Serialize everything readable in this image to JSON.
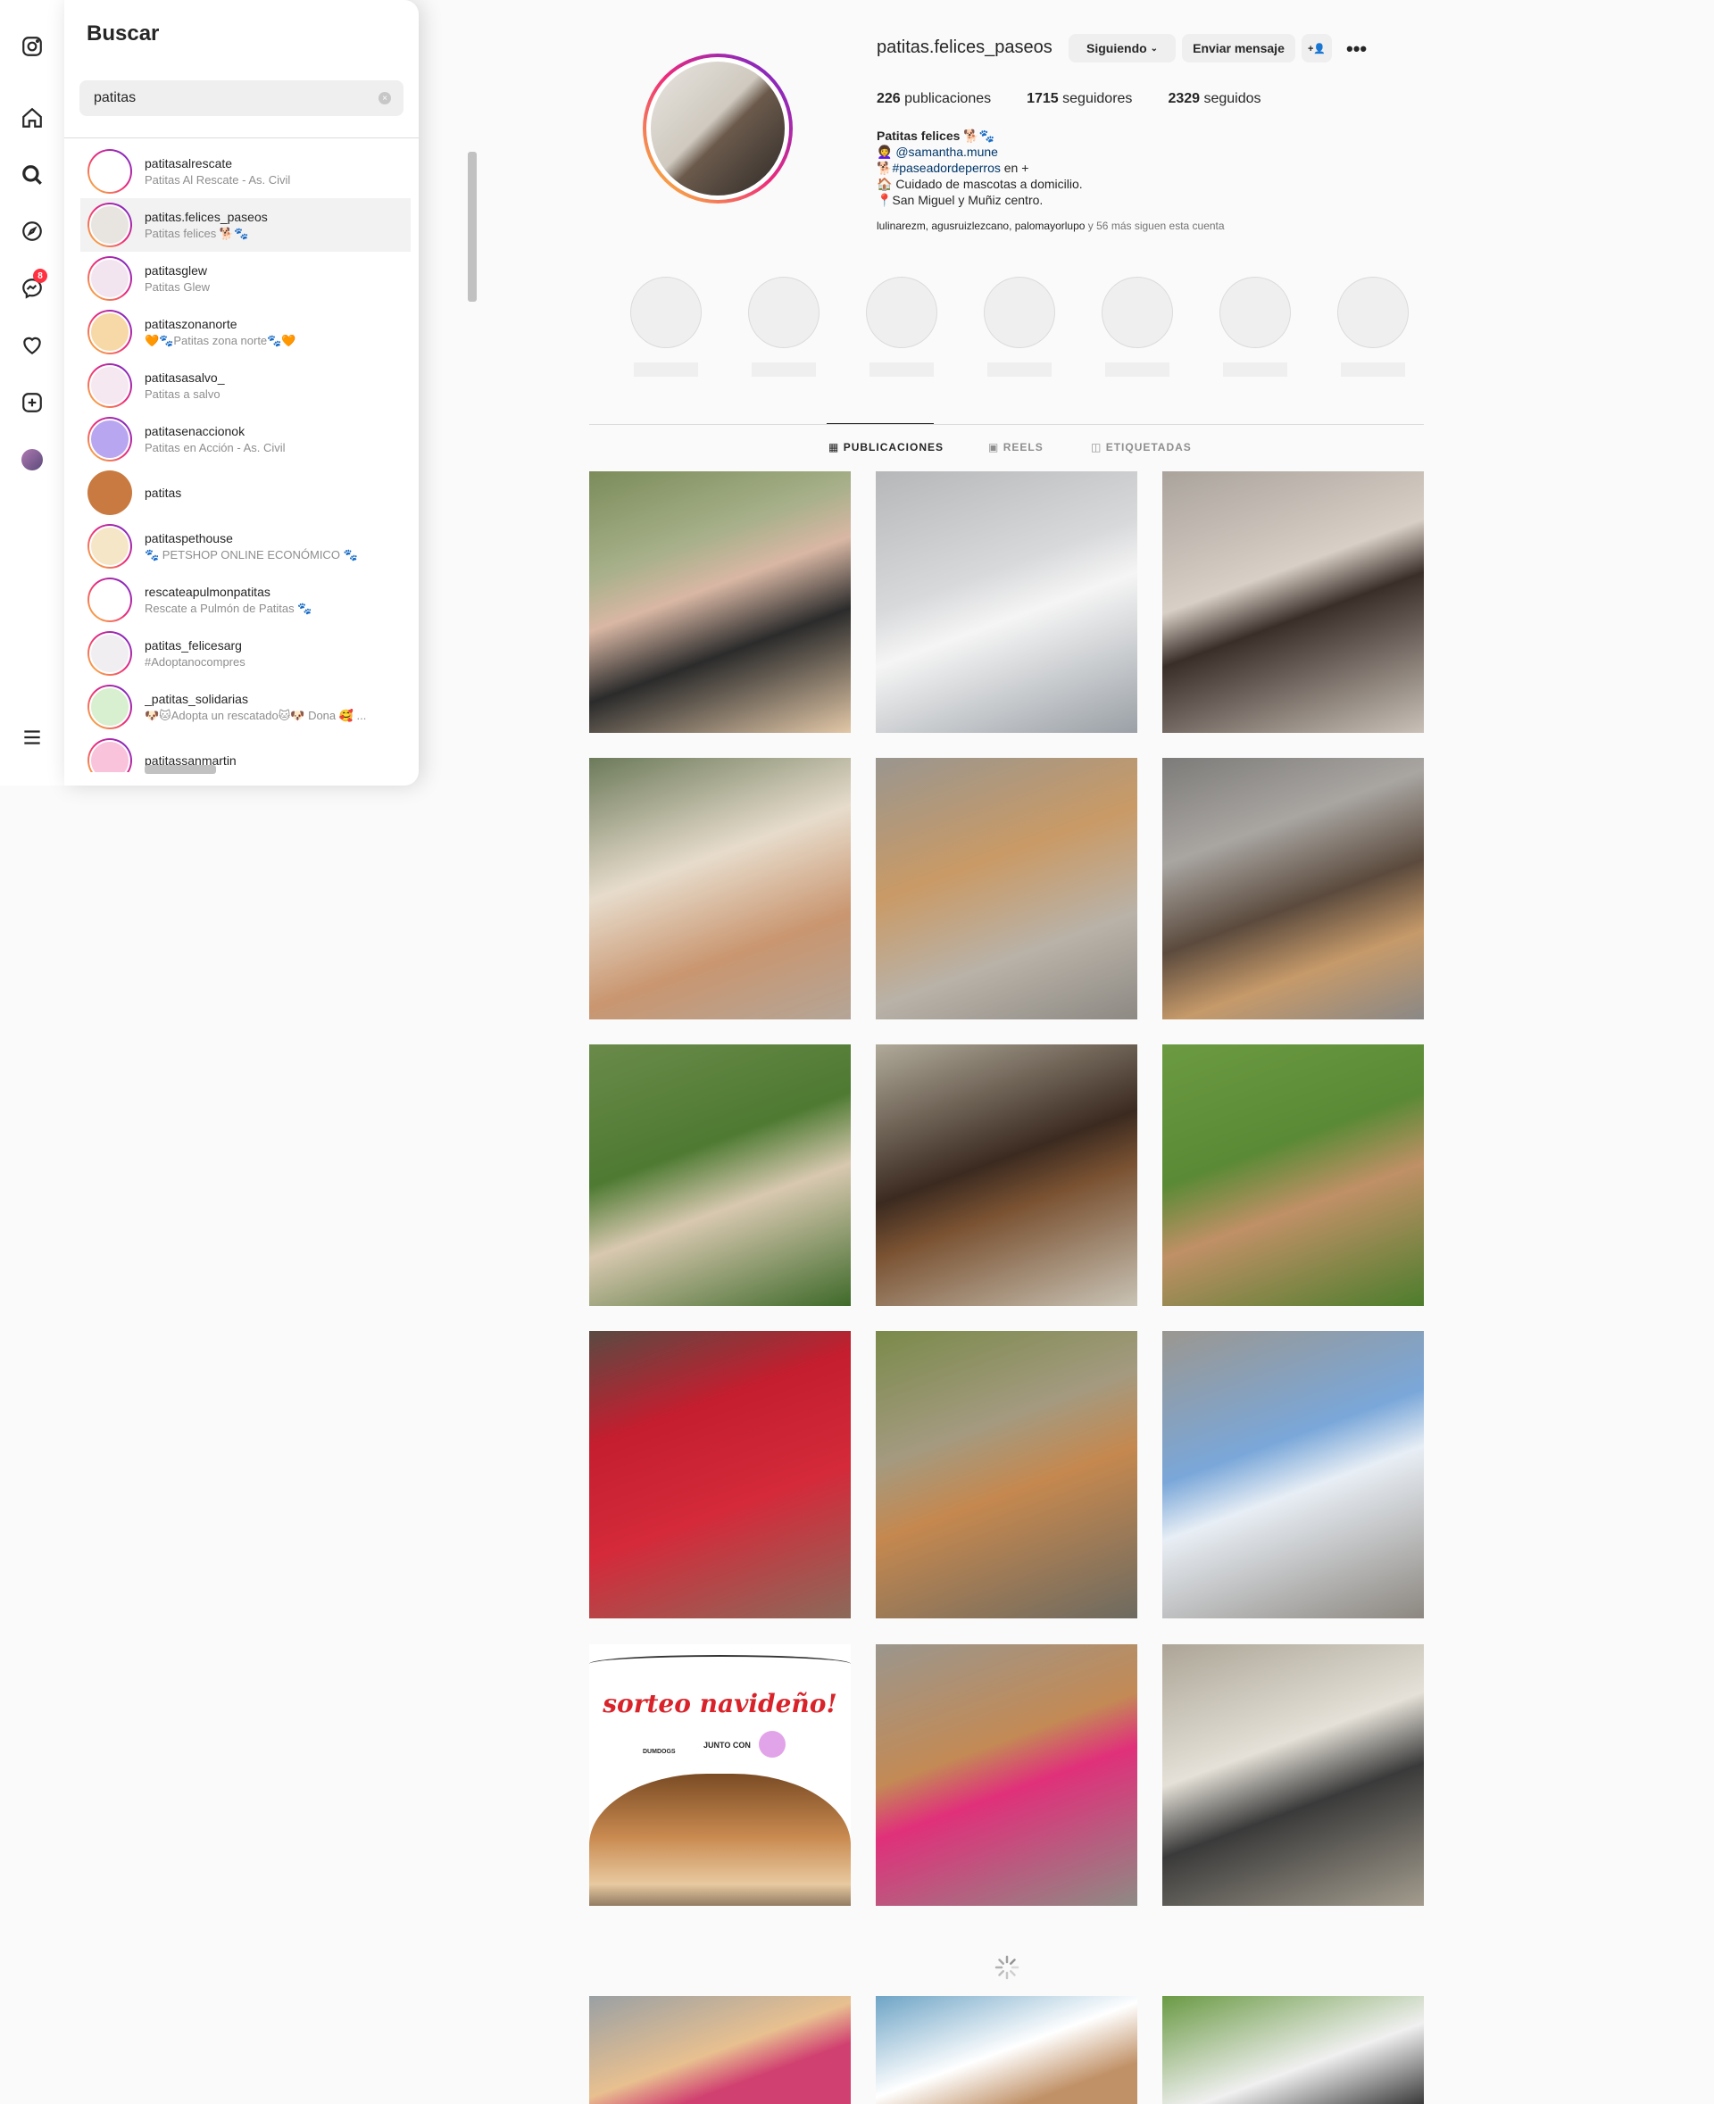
{
  "rail": {
    "icons": [
      "instagram-icon",
      "home-icon",
      "search-icon",
      "explore-icon",
      "messenger-icon",
      "heart-icon",
      "create-icon",
      "profile-avatar",
      "menu-icon"
    ],
    "messenger_badge": "8"
  },
  "search": {
    "title": "Buscar",
    "query": "patitas",
    "clear_icon": "×",
    "results": [
      {
        "username": "patitasalrescate",
        "subtitle": "Patitas Al Rescate - As. Civil"
      },
      {
        "username": "patitas.felices_paseos",
        "subtitle": "Patitas felices 🐕🐾"
      },
      {
        "username": "patitasglew",
        "subtitle": "Patitas Glew"
      },
      {
        "username": "patitaszonanorte",
        "subtitle": "🧡🐾Patitas zona norte🐾🧡"
      },
      {
        "username": "patitasasalvo_",
        "subtitle": "Patitas a salvo"
      },
      {
        "username": "patitasenaccionok",
        "subtitle": "Patitas en Acción - As. Civil"
      },
      {
        "username": "patitas",
        "subtitle": ""
      },
      {
        "username": "patitaspethouse",
        "subtitle": "🐾 PETSHOP ONLINE ECONÓMICO 🐾"
      },
      {
        "username": "rescateapulmonpatitas",
        "subtitle": "Rescate a Pulmón de Patitas 🐾"
      },
      {
        "username": "patitas_felicesarg",
        "subtitle": "#Adoptanocompres"
      },
      {
        "username": "_patitas_solidarias",
        "subtitle": "🐶🐱Adopta un rescatado🐱🐶 Dona 🥰 ..."
      },
      {
        "username": "patitassanmartin",
        "subtitle": ""
      }
    ]
  },
  "profile": {
    "username": "patitas.felices_paseos",
    "following_label": "Siguiendo",
    "message_label": "Enviar mensaje",
    "suggest_icon": "+👤",
    "more_icon": "•••",
    "posts_count": "226",
    "posts_label": "publicaciones",
    "followers_count": "1715",
    "followers_label": "seguidores",
    "following_count": "2329",
    "following_label2": "seguidos",
    "bio_name": "Patitas felices 🐕🐾",
    "bio_line1_icon": "👩‍🦱",
    "bio_line1": "@samantha.mune",
    "bio_line2_icon": "🐕",
    "bio_line2_tag": "#paseadordeperros",
    "bio_line2_rest": " en +",
    "bio_line3": "🏠 Cuidado de mascotas a domicilio.",
    "bio_line4": "📍San Miguel y Muñiz centro.",
    "followed_by_names": "lulinarezm, agusruizlezcano, palomayorlupo",
    "followed_by_rest": " y 56 más siguen esta cuenta"
  },
  "tabs": [
    {
      "label": "Publicaciones",
      "icon": "grid-icon"
    },
    {
      "label": "Reels",
      "icon": "reels-icon"
    },
    {
      "label": "Etiquetadas",
      "icon": "tagged-icon"
    }
  ],
  "posts": {
    "rows": 5,
    "partial_row": true,
    "giveaway": {
      "title": "sorteo navideño!",
      "brand": "DUMDOGS",
      "junto_con": "JUNTO CON"
    }
  }
}
